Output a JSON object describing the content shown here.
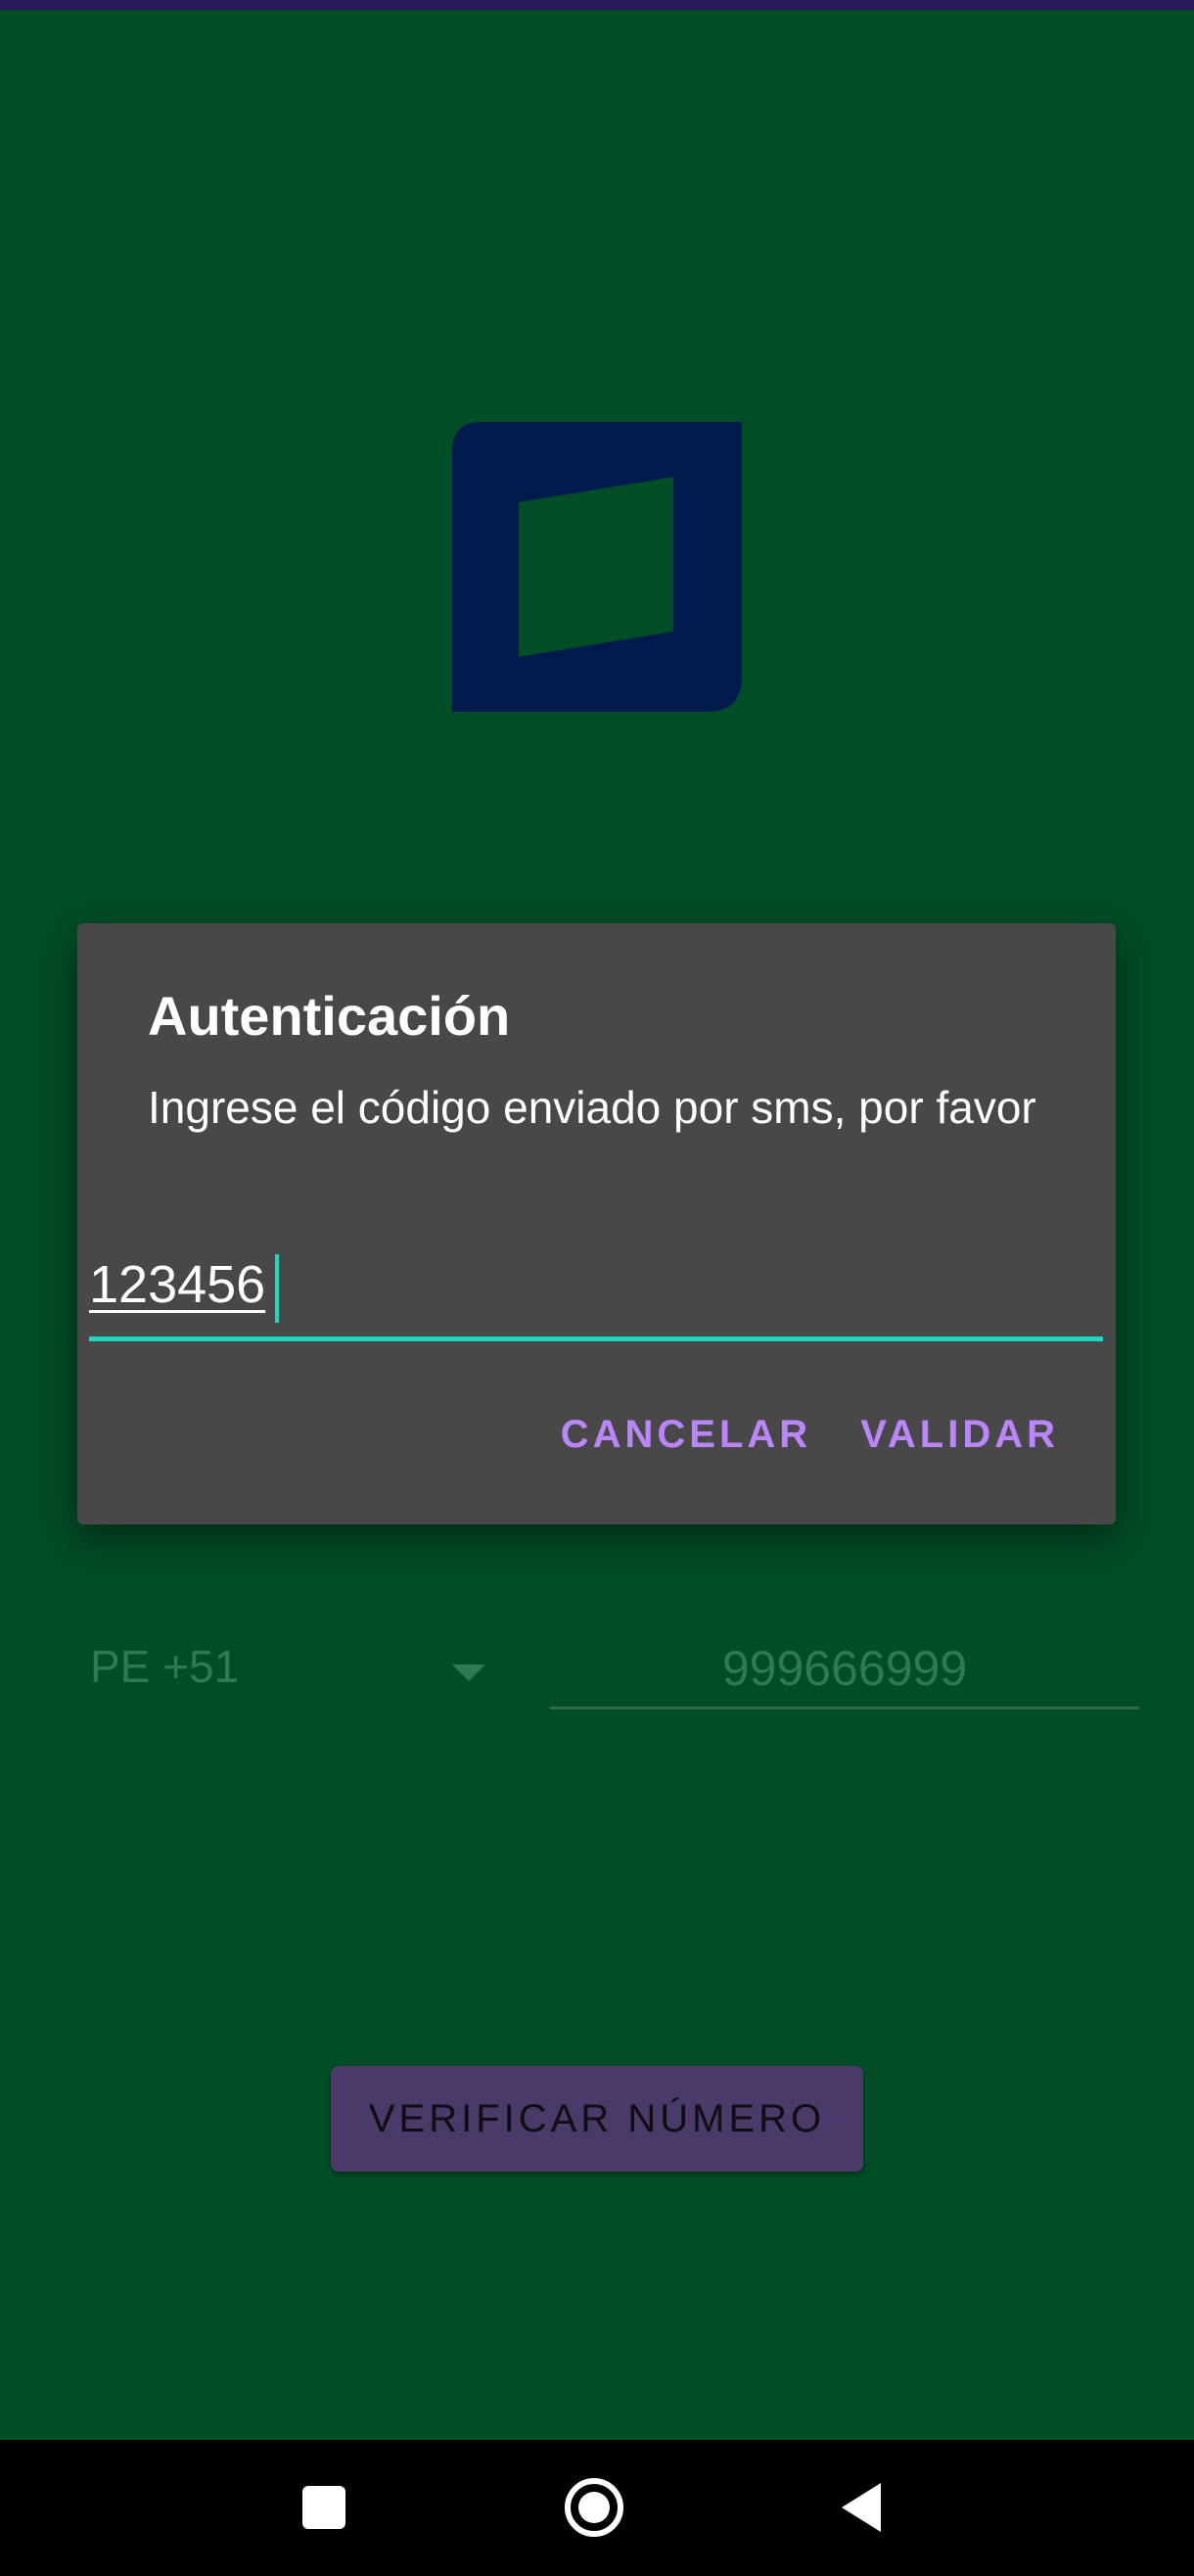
{
  "dialog": {
    "title": "Autenticación",
    "message": "Ingrese el código enviado por sms, por favor",
    "code_value": "123456",
    "cancel_label": "CANCELAR",
    "validate_label": "VALIDAR"
  },
  "form": {
    "country_code": "PE +51",
    "phone_value": "999666999"
  },
  "verify_button_label": "VERIFICAR NÚMERO",
  "icons": {
    "logo": "app-logo",
    "dropdown": "dropdown-arrow-icon",
    "nav_recents": "square-icon",
    "nav_home": "circle-icon",
    "nav_back": "back-triangle-icon"
  },
  "colors": {
    "background": "#004d26",
    "dialog": "#484848",
    "accent": "#1fd6c3",
    "action": "#bb86fc",
    "logo": "#001a4d",
    "verify_button": "#4a3a6a"
  }
}
